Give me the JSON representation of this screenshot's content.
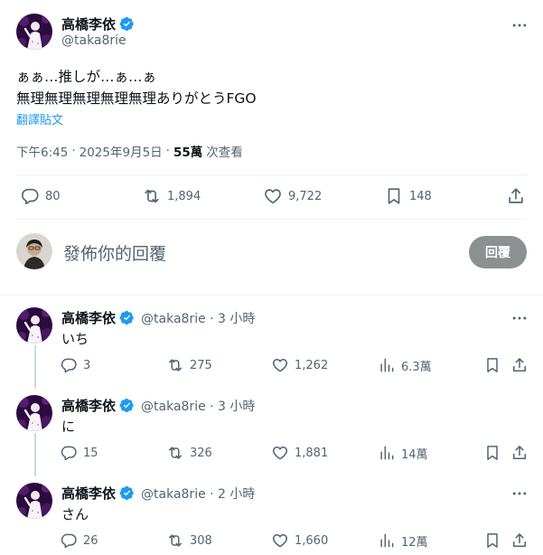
{
  "main_tweet": {
    "display_name": "高橋李依",
    "handle": "@taka8rie",
    "text_line1": "ぁぁ…推しが…ぁ…ぁ",
    "text_line2": "無理無理無理無理無理ありがとうFGO",
    "translate_label": "翻譯貼文",
    "time": "下午6:45",
    "dot1": "·",
    "date": "2025年9月5日",
    "dot2": "·",
    "views_count": "55萬",
    "views_label": "次查看",
    "replies": "80",
    "reposts": "1,894",
    "likes": "9,722",
    "bookmarks": "148"
  },
  "reply_composer": {
    "placeholder": "發佈你的回覆",
    "button_label": "回覆"
  },
  "replies": [
    {
      "display_name": "高橋李依",
      "handle_time": "@taka8rie · 3 小時",
      "text": "いち",
      "replies": "3",
      "reposts": "275",
      "likes": "1,262",
      "views": "6.3萬"
    },
    {
      "display_name": "高橋李依",
      "handle_time": "@taka8rie · 3 小時",
      "text": "に",
      "replies": "15",
      "reposts": "326",
      "likes": "1,881",
      "views": "14萬"
    },
    {
      "display_name": "高橋李依",
      "handle_time": "@taka8rie · 2 小時",
      "text": "さん",
      "replies": "26",
      "reposts": "308",
      "likes": "1,660",
      "views": "12萬"
    }
  ],
  "colors": {
    "accent": "#1d9bf0",
    "muted_text": "#536471",
    "divider": "#eff3f4",
    "reply_button_bg": "#8c9091"
  },
  "icons": [
    "verified-badge-icon",
    "more-icon",
    "reply-icon",
    "repost-icon",
    "like-icon",
    "bookmark-icon",
    "share-icon",
    "views-icon"
  ]
}
